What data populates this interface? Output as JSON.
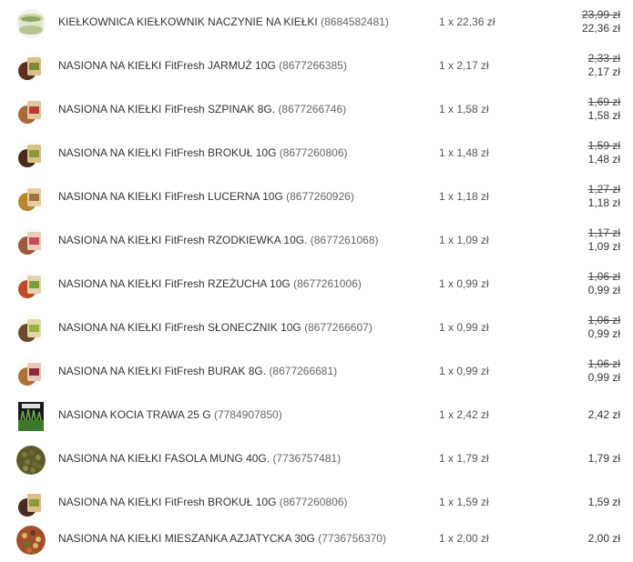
{
  "items": [
    {
      "name": "KIEŁKOWNICA KIEŁKOWNIK NACZYNIE NA KIEŁKI",
      "sku": "(8684582481)",
      "qty": "1 x 22,36 zł",
      "old_price": "23,99 zł",
      "price": "22,36 zł",
      "icon": "sprouter-jar-icon"
    },
    {
      "name": "NASIONA NA KIEŁKI FitFresh JARMUŻ 10G",
      "sku": "(8677266385)",
      "qty": "1 x 2,17 zł",
      "old_price": "2,33 zł",
      "price": "2,17 zł",
      "icon": "seed-packet-icon"
    },
    {
      "name": "NASIONA NA KIEŁKI FitFresh SZPINAK 8G.",
      "sku": "(8677266746)",
      "qty": "1 x 1,58 zł",
      "old_price": "1,69 zł",
      "price": "1,58 zł",
      "icon": "seed-packet-icon"
    },
    {
      "name": "NASIONA NA KIEŁKI FitFresh BROKUŁ 10G",
      "sku": "(8677260806)",
      "qty": "1 x 1,48 zł",
      "old_price": "1,59 zł",
      "price": "1,48 zł",
      "icon": "seed-packet-icon"
    },
    {
      "name": "NASIONA NA KIEŁKI FitFresh LUCERNA 10G",
      "sku": "(8677260926)",
      "qty": "1 x 1,18 zł",
      "old_price": "1,27 zł",
      "price": "1,18 zł",
      "icon": "seed-packet-icon"
    },
    {
      "name": "NASIONA NA KIEŁKI FitFresh RZODKIEWKA 10G.",
      "sku": "(8677261068)",
      "qty": "1 x 1,09 zł",
      "old_price": "1,17 zł",
      "price": "1,09 zł",
      "icon": "seed-packet-icon"
    },
    {
      "name": "NASIONA NA KIEŁKI FitFresh RZEŻUCHA 10G",
      "sku": "(8677261006)",
      "qty": "1 x 0,99 zł",
      "old_price": "1,06 zł",
      "price": "0,99 zł",
      "icon": "seed-packet-icon"
    },
    {
      "name": "NASIONA NA KIEŁKI FitFresh SŁONECZNIK 10G",
      "sku": "(8677266607)",
      "qty": "1 x 0,99 zł",
      "old_price": "1,06 zł",
      "price": "0,99 zł",
      "icon": "seed-packet-icon"
    },
    {
      "name": "NASIONA NA KIEŁKI FitFresh BURAK 8G.",
      "sku": "(8677266681)",
      "qty": "1 x 0,99 zł",
      "old_price": "1,06 zł",
      "price": "0,99 zł",
      "icon": "seed-packet-icon"
    },
    {
      "name": "NASIONA KOCIA TRAWA 25 G",
      "sku": "(7784907850)",
      "qty": "1 x 2,42 zł",
      "old_price": "",
      "price": "2,42 zł",
      "icon": "cat-grass-icon"
    },
    {
      "name": "NASIONA NA KIEŁKI FASOLA MUNG 40G.",
      "sku": "(7736757481)",
      "qty": "1 x 1,79 zł",
      "old_price": "",
      "price": "1,79 zł",
      "icon": "mung-beans-icon"
    },
    {
      "name": "NASIONA NA KIEŁKI FitFresh BROKUŁ 10G",
      "sku": "(8677260806)",
      "qty": "1 x 1,59 zł",
      "old_price": "",
      "price": "1,59 zł",
      "icon": "seed-packet-icon"
    },
    {
      "name": "NASIONA NA KIEŁKI MIESZANKA AZJATYCKA 30G",
      "sku": "(7736756370)",
      "qty": "1 x 2,00 zł",
      "old_price": "",
      "price": "2,00 zł",
      "icon": "seed-mix-icon"
    }
  ]
}
